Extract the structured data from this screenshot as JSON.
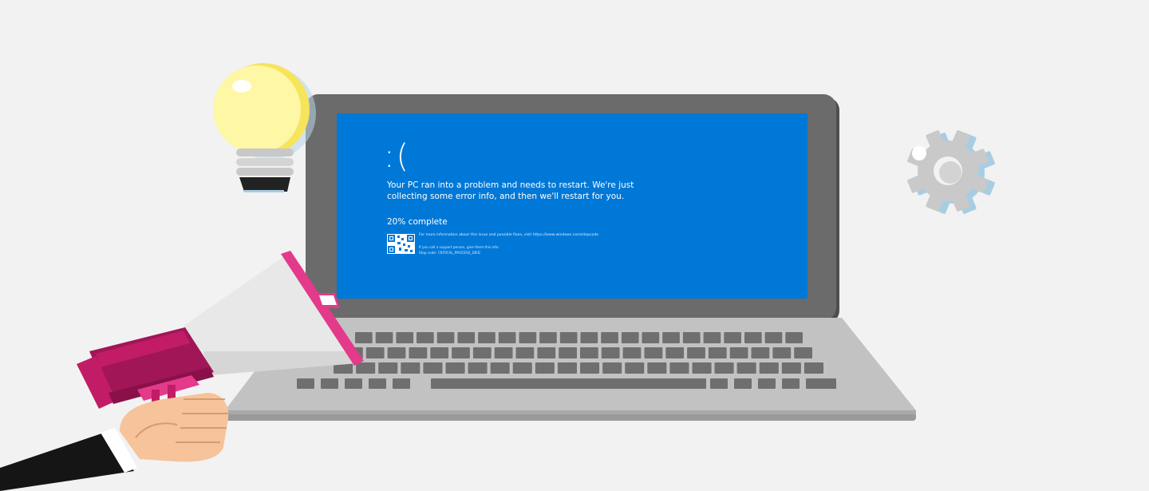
{
  "bsod": {
    "face": ":(",
    "message": "Your PC ran into a problem and needs to restart. We're just collecting some error info, and then we'll restart for you.",
    "progress_text": "20% complete",
    "progress_value": 20,
    "more_info": "For more information about this issue and possible fixes, visit https://www.windows.com/stopcode",
    "support_line": "If you call a support person, give them this info:",
    "stop_code": "Stop code: CRITICAL_PROCESS_DIED"
  },
  "icons": [
    "lightbulb-icon",
    "gear-icon",
    "megaphone-icon",
    "laptop-icon",
    "qr-code-icon"
  ],
  "colors": {
    "background": "#f2f2f2",
    "screen_blue": "#0078d7",
    "laptop_frame": "#6b6b6b",
    "laptop_body": "#c3c3c3",
    "megaphone_magenta": "#b0175f",
    "megaphone_pink": "#e33a8b",
    "bulb_yellow": "#fef6a2",
    "gear_gray": "#c9c9c9"
  }
}
